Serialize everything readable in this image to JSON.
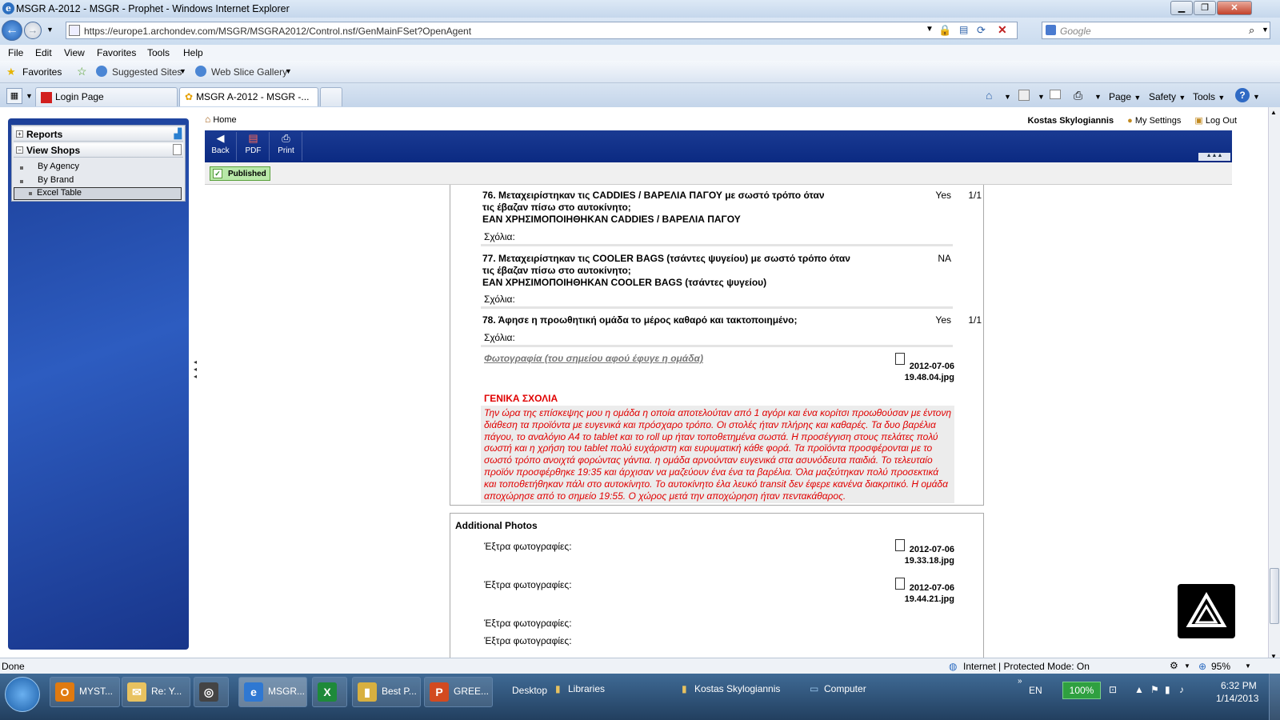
{
  "window": {
    "title": "MSGR A-2012 - MSGR - Prophet - Windows Internet Explorer"
  },
  "address": {
    "url": "https://europe1.archondev.com/MSGR/MSGRA2012/Control.nsf/GenMainFSet?OpenAgent",
    "search_placeholder": "Google"
  },
  "menu": [
    "File",
    "Edit",
    "View",
    "Favorites",
    "Tools",
    "Help"
  ],
  "favorites": {
    "label": "Favorites",
    "suggested": "Suggested Sites",
    "webslice": "Web Slice Gallery"
  },
  "tabs": [
    {
      "label": "Login Page"
    },
    {
      "label": "MSGR A-2012 - MSGR -..."
    }
  ],
  "commandbar": {
    "page": "Page",
    "safety": "Safety",
    "tools": "Tools"
  },
  "sidebar": {
    "reports": "Reports",
    "view_shops": "View Shops",
    "items": [
      "By Agency",
      "By Brand",
      "Excel Table"
    ]
  },
  "page": {
    "home": "Home",
    "user": "Kostas Skylogiannis",
    "settings": "My Settings",
    "logout": "Log Out",
    "toolbar": {
      "back": "Back",
      "pdf": "PDF",
      "print": "Print"
    },
    "status": "Published"
  },
  "questions": [
    {
      "text": "76. Μεταχειρίστηκαν τις CADDIES / ΒΑΡΕΛΙΑ ΠΑΓΟΥ με σωστό τρόπο όταν τις έβαζαν πίσω στο αυτοκίνητο;\nΕΑΝ ΧΡΗΣΙΜΟΠΟΙΗΘΗΚΑΝ CADDIES / ΒΑΡΕΛΙΑ ΠΑΓΟΥ",
      "answer": "Yes",
      "score": "1/1",
      "comments": "Σχόλια:"
    },
    {
      "text": "77. Μεταχειρίστηκαν τις COOLER BAGS (τσάντες ψυγείου) με σωστό τρόπο όταν τις έβαζαν πίσω στο αυτοκίνητο;\nΕΑΝ ΧΡΗΣΙΜΟΠΟΙΗΘΗΚΑΝ COOLER BAGS (τσάντες ψυγείου)",
      "answer": "NA",
      "score": "",
      "comments": "Σχόλια:"
    },
    {
      "text": "78. Άφησε η προωθητική ομάδα το μέρος καθαρό και τακτοποιημένο;",
      "answer": "Yes",
      "score": "1/1",
      "comments": "Σχόλια:"
    }
  ],
  "photo": {
    "label": "Φωτογραφία (του σημείου αφού έφυγε η ομάδα)",
    "file_line1": "2012-07-06",
    "file_line2": "19.48.04.jpg"
  },
  "general": {
    "header": "ΓΕΝΙΚΑ ΣΧΟΛΙΑ",
    "text": "Την ώρα της επίσκεψης μου η ομάδα η οποία αποτελούταν από 1 αγόρι και ένα κορίτσι προωθούσαν με έντονη διάθεση τα προϊόντα με ευγενικά και πρόσχαρο τρόπο. Οι στολές ήταν πλήρης και καθαρές. Τα δυο βαρέλια πάγου, το αναλόγιο Α4 το tablet και το roll up ήταν τοποθετημένα σωστά. Η προσέγγιση στους πελάτες πολύ σωστή και η χρήση του tablet πολύ ευχάριστη και ευρυματική κάθε φορά. Τα προϊόντα προσφέρονται με το σωστό τρόπο ανοιχτά φορώντας γάντια. η ομάδα αρνούνταν ευγενικά στα ασυνόδευτα παιδιά. Το τελευταίο προϊόν προσφέρθηκε 19:35 και άρχισαν να μαζεύουν ένα ένα τα βαρέλια. Όλα μαζεύτηκαν πολύ προσεκτικά και τοποθετήθηκαν πάλι στο αυτοκίνητο. Το αυτοκίνητο έλα λευκό transit δεν έφερε κανένα διακριτικό. Η ομάδα αποχώρησε από το σημείο 19:55. Ο χώρος μετά την αποχώρηση ήταν πεντακάθαρος."
  },
  "additional": {
    "header": "Additional Photos",
    "rows": [
      {
        "label": "Έξτρα φωτογραφίες:",
        "file_line1": "2012-07-06",
        "file_line2": "19.33.18.jpg"
      },
      {
        "label": "Έξτρα φωτογραφίες:",
        "file_line1": "2012-07-06",
        "file_line2": "19.44.21.jpg"
      },
      {
        "label": "Έξτρα φωτογραφίες:",
        "file_line1": "",
        "file_line2": ""
      },
      {
        "label": "Έξτρα φωτογραφίες:",
        "file_line1": "",
        "file_line2": ""
      }
    ]
  },
  "statusbar": {
    "left": "Done",
    "zone": "Internet | Protected Mode: On",
    "zoom": "95%"
  },
  "taskbar": {
    "buttons": [
      "MYST...",
      "Re: Y...",
      "MSGR...",
      "Best P...",
      "GREE..."
    ],
    "desktop": "Desktop",
    "libraries": "Libraries",
    "user": "Kostas Skylogiannis",
    "computer": "Computer",
    "lang": "EN",
    "battery": "100%",
    "time": "6:32 PM",
    "date": "1/14/2013"
  }
}
